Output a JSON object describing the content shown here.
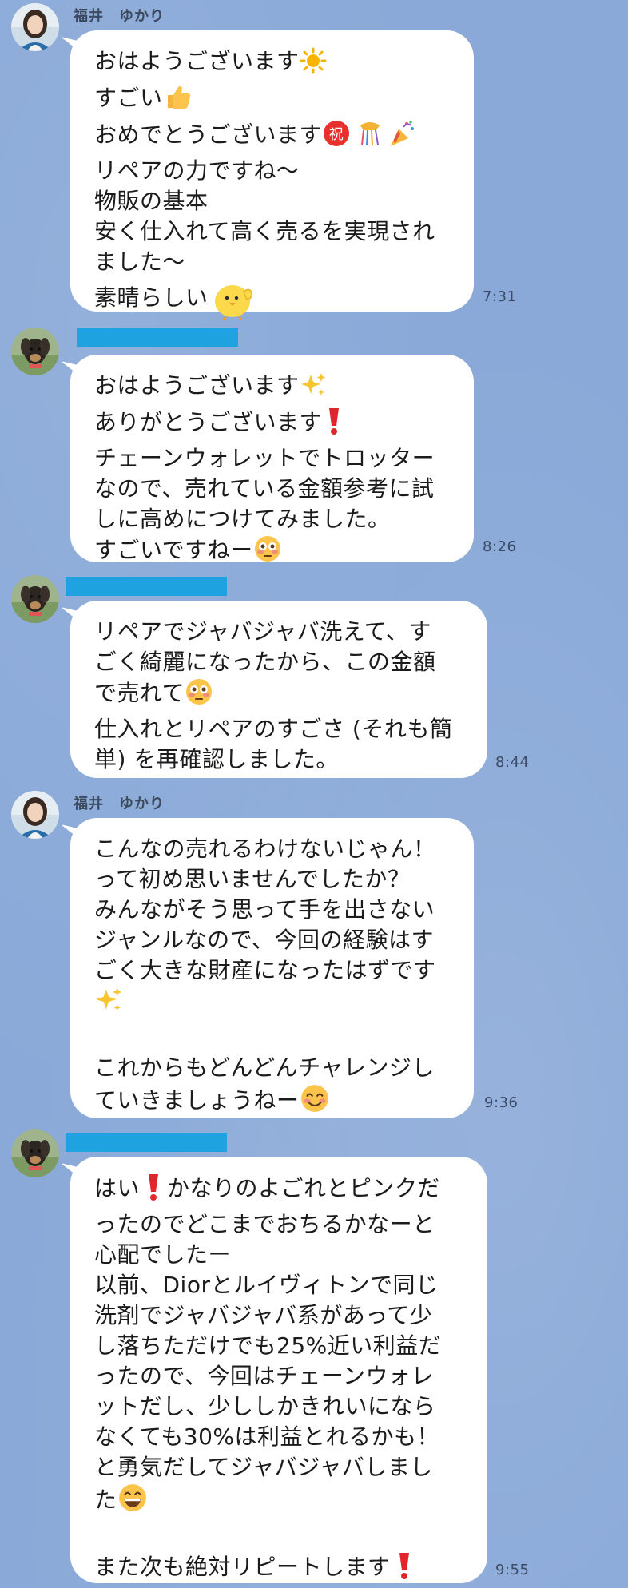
{
  "messages": [
    {
      "sender": "福井　ゆかり",
      "lines": [
        "おはようございます",
        "すごい",
        "おめでとうございます",
        "リペアの力ですね〜",
        "物販の基本",
        "安く仕入れて高く売るを実現され",
        "ました〜",
        "素晴らしい"
      ],
      "time": "7:31"
    },
    {
      "sender": "",
      "lines": [
        "おはようございます",
        "ありがとうございます",
        "チェーンウォレットでトロッター",
        "なので、売れている金額参考に試",
        "しに高めにつけてみました。",
        "すごいですねー"
      ],
      "time": "8:26"
    },
    {
      "sender": "",
      "lines": [
        "リペアでジャバジャバ洗えて、す",
        "ごく綺麗になったから、この金額",
        "で売れて",
        "仕入れとリペアのすごさ (それも簡",
        "単) を再確認しました。"
      ],
      "time": "8:44"
    },
    {
      "sender": "福井　ゆかり",
      "lines": [
        "こんなの売れるわけないじゃん！",
        "って初め思いませんでしたか？",
        "みんながそう思って手を出さない",
        "ジャンルなので、今回の経験はす",
        "ごく大きな財産になったはずです",
        "",
        "",
        "これからもどんどんチャレンジし",
        "ていきましょうねー"
      ],
      "time": "9:36"
    },
    {
      "sender": "",
      "lines": [
        "はい",
        "かなりのよごれとピンクだ",
        "ったのでどこまでおちるかなーと",
        "心配でしたー",
        "以前、Diorとルイヴィトンで同じ",
        "洗剤でジャバジャバ系があって少",
        "し落ちただけでも25%近い利益だ",
        "ったので、今回はチェーンウォレ",
        "ットだし、少ししかきれいになら",
        "なくても30%は利益とれるかも！",
        "と勇気だしてジャバジャバしまし",
        "た",
        "",
        "また次も絶対リピートします"
      ],
      "time": "9:55"
    }
  ],
  "icons": {
    "sun": "sun-emoji",
    "thumbs_up": "thumbs-up-emoji",
    "congrats": "congratulations-kanji-emoji",
    "ribbon": "confetti-ball-emoji",
    "party": "party-popper-emoji",
    "chick": "chick-thumbs-up-sticker",
    "sparkles": "sparkles-emoji",
    "exclamation": "red-exclamation-emoji",
    "flushed": "flushed-face-emoji",
    "smile": "smiling-face-emoji",
    "grin": "grinning-face-emoji"
  },
  "colors": {
    "background": "#8aa9d8",
    "bubble": "#ffffff",
    "redaction": "#1ea3e0",
    "time_text": "#3b4b66"
  }
}
